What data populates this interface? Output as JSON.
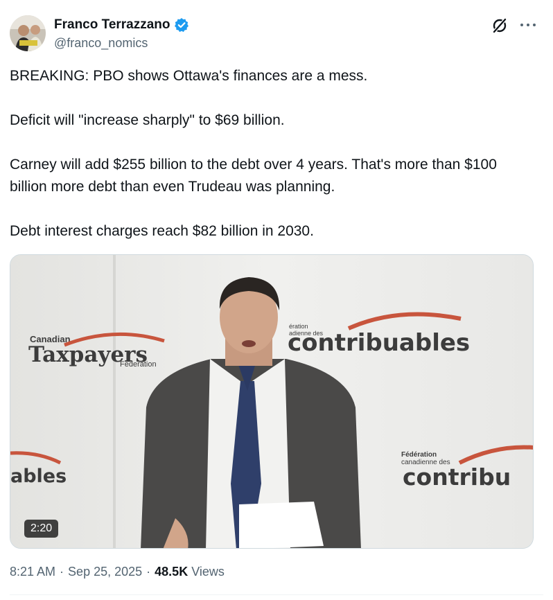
{
  "author": {
    "display_name": "Franco Terrazzano",
    "handle": "@franco_nomics",
    "verified": true,
    "verified_color": "#1d9bf0"
  },
  "tweet": {
    "paragraphs": [
      "BREAKING: PBO shows Ottawa's finances are a mess.",
      "Deficit will \"increase sharply\" to $69 billion.",
      "Carney will add $255 billion to the debt over 4 years. That's more than $100 billion more debt than even Trudeau was planning.",
      "Debt interest charges reach $82 billion in 2030."
    ]
  },
  "video": {
    "duration": "2:20",
    "backdrop": {
      "logo_left_small": "Canadian",
      "logo_left_big": "Taxpayers",
      "logo_left_sub": "Federation",
      "logo_center_small_1": "ération",
      "logo_center_small_2": "adienne des",
      "logo_center_big": "contribuables",
      "logo_edge_left_big": "ables",
      "logo_right_small_1": "Fédération",
      "logo_right_small_2": "canadienne des",
      "logo_right_big": "contribu",
      "accent_color": "#c8553d",
      "text_color": "#3c3c3c"
    }
  },
  "meta": {
    "time": "8:21 AM",
    "separator": "·",
    "date": "Sep 25, 2025",
    "views_count": "48.5K",
    "views_label": "Views"
  },
  "icons": {
    "grok": "grok-icon",
    "more": "more-icon",
    "verified": "verified-badge-icon"
  }
}
